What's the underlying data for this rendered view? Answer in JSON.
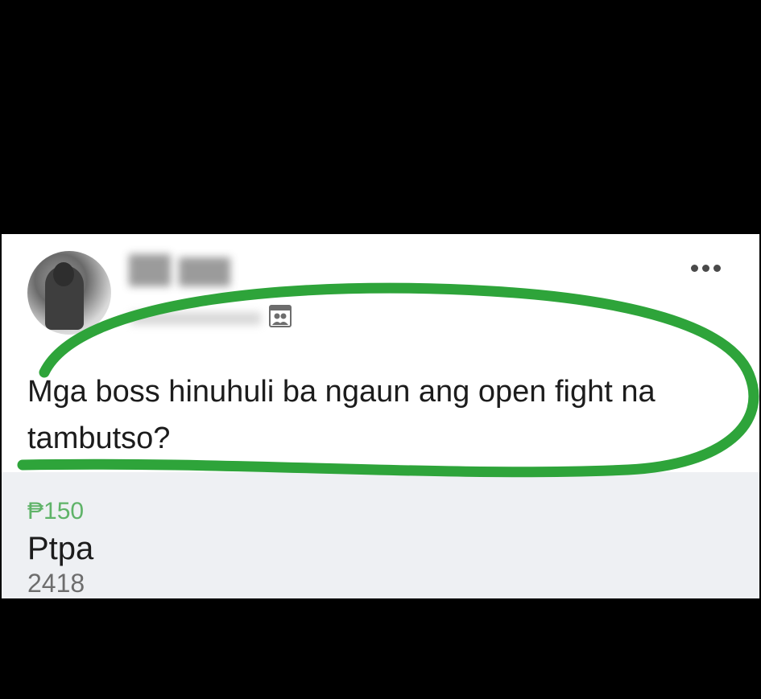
{
  "post": {
    "text": "Mga boss hinuhuli ba ngaun ang open fight na tambutso?",
    "author_avatar_icon": "user-avatar",
    "audience_icon": "audience-group-icon",
    "more_icon": "more-options-icon",
    "highlight_color": "#2ea43a"
  },
  "listing": {
    "price": "₱150",
    "title": "Ptpa",
    "subtitle": "2418",
    "price_color": "#5fb368"
  }
}
